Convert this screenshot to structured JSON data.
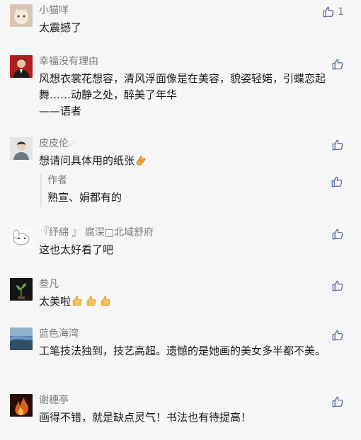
{
  "comments": [
    {
      "name": "小猫咩",
      "text": "太震撼了",
      "likes": "1",
      "avatar_icon": "cat-avatar"
    },
    {
      "name": "幸福没有理由",
      "text": "风想衣裳花想容，清风浮面像是在美容，貌姿轻婼，引蝶恋起舞……动静之处，醉美了年华",
      "text2": "——语者",
      "likes": "",
      "avatar_icon": "man-portrait-avatar"
    },
    {
      "name": "皮皮伦",
      "text": "想请问具体用的纸张",
      "likes": "",
      "avatar_icon": "boy-portrait-avatar",
      "reply": {
        "author": "作者",
        "text": "熟宣、娟都有的"
      }
    },
    {
      "name": "『纾綿 』 腐深□北域舒府",
      "text": "这也太好看了吧",
      "likes": "",
      "avatar_icon": "cartoon-dog-avatar"
    },
    {
      "name": "叁凡",
      "text": "太美啦",
      "likes": "",
      "avatar_icon": "plant-avatar"
    },
    {
      "name": "蓝色海湾",
      "text": "工笔技法独到，技艺高超。遗憾的是她画的美女多半都不美。",
      "likes": "",
      "avatar_icon": "seascape-avatar"
    },
    {
      "name": "谢穗亭",
      "text": "画得不错，就是缺点灵气！书法也有待提高！",
      "likes": "",
      "avatar_icon": "fire-avatar"
    }
  ],
  "colors": {
    "background": "#f6f6f6",
    "meta_gray": "#7a7a7a",
    "like_blue": "#576b95"
  }
}
